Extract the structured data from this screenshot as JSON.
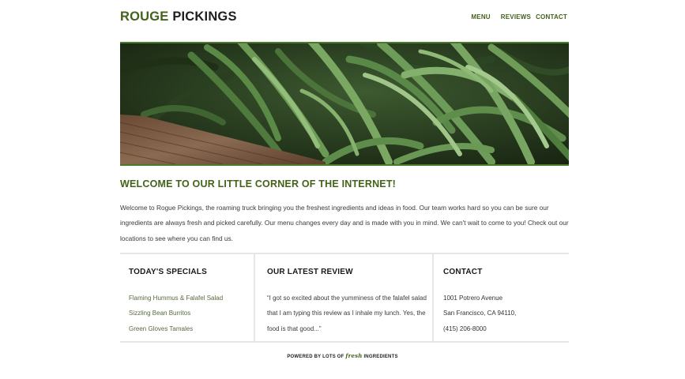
{
  "header": {
    "brand_word1": "ROUGE",
    "brand_word2": "PICKINGS",
    "nav": {
      "menu": "MENU",
      "reviews": "REVIEWS",
      "contact": "CONTACT"
    }
  },
  "hero": {
    "image": "green-beans-photo"
  },
  "welcome": {
    "title": "WELCOME TO OUR LITTLE CORNER OF THE INTERNET!",
    "text": "Welcome to Rogue Pickings, the roaming truck bringing you the freshest ingredients and ideas in food. Our team works hard so you can be sure our ingredients are always fresh and picked carefully. Our menu changes every day and is made with you in mind. We can't wait to come to you! Check out our locations to see where you can find us."
  },
  "specials": {
    "title": "TODAY'S SPECIALS",
    "items": [
      "Flaming Hummus & Falafel Salad",
      "Sizzling Bean Burritos",
      "Green Gloves Tamales"
    ]
  },
  "review": {
    "title": "OUR LATEST REVIEW",
    "text": "“I got so excited about the yumminess of the falafel salad that I am typing this review as I inhale my lunch. Yes, the food is that good...”"
  },
  "contact": {
    "title": "CONTACT",
    "lines": [
      "1001 Potrero Avenue",
      "San Francisco, CA 94110,",
      "(415) 206-8000"
    ]
  },
  "footer": {
    "prefix": "POWERED BY LOTS OF",
    "fresh": "fresh",
    "suffix": "INGREDIENTS"
  },
  "colors": {
    "accent": "#43621a",
    "rule": "#4c7a2c",
    "divider": "#e6e6e6"
  }
}
